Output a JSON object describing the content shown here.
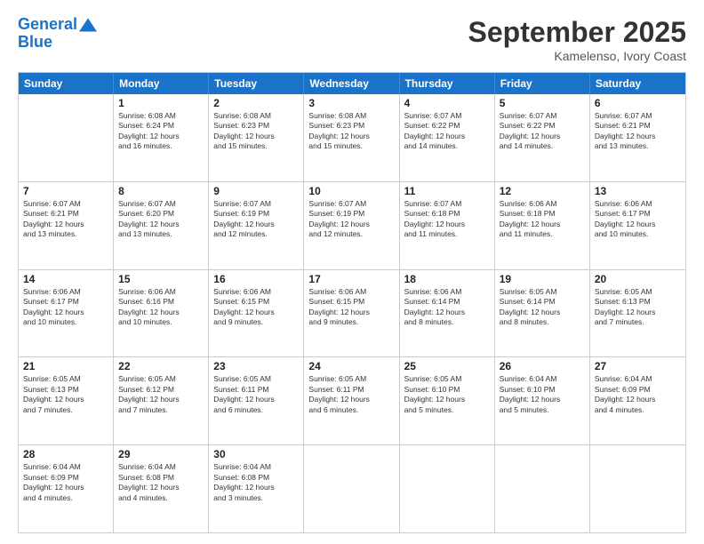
{
  "header": {
    "logo_line1": "General",
    "logo_line2": "Blue",
    "month": "September 2025",
    "location": "Kamelenso, Ivory Coast"
  },
  "days_of_week": [
    "Sunday",
    "Monday",
    "Tuesday",
    "Wednesday",
    "Thursday",
    "Friday",
    "Saturday"
  ],
  "weeks": [
    [
      {
        "day": "",
        "info": ""
      },
      {
        "day": "1",
        "info": "Sunrise: 6:08 AM\nSunset: 6:24 PM\nDaylight: 12 hours\nand 16 minutes."
      },
      {
        "day": "2",
        "info": "Sunrise: 6:08 AM\nSunset: 6:23 PM\nDaylight: 12 hours\nand 15 minutes."
      },
      {
        "day": "3",
        "info": "Sunrise: 6:08 AM\nSunset: 6:23 PM\nDaylight: 12 hours\nand 15 minutes."
      },
      {
        "day": "4",
        "info": "Sunrise: 6:07 AM\nSunset: 6:22 PM\nDaylight: 12 hours\nand 14 minutes."
      },
      {
        "day": "5",
        "info": "Sunrise: 6:07 AM\nSunset: 6:22 PM\nDaylight: 12 hours\nand 14 minutes."
      },
      {
        "day": "6",
        "info": "Sunrise: 6:07 AM\nSunset: 6:21 PM\nDaylight: 12 hours\nand 13 minutes."
      }
    ],
    [
      {
        "day": "7",
        "info": "Sunrise: 6:07 AM\nSunset: 6:21 PM\nDaylight: 12 hours\nand 13 minutes."
      },
      {
        "day": "8",
        "info": "Sunrise: 6:07 AM\nSunset: 6:20 PM\nDaylight: 12 hours\nand 13 minutes."
      },
      {
        "day": "9",
        "info": "Sunrise: 6:07 AM\nSunset: 6:19 PM\nDaylight: 12 hours\nand 12 minutes."
      },
      {
        "day": "10",
        "info": "Sunrise: 6:07 AM\nSunset: 6:19 PM\nDaylight: 12 hours\nand 12 minutes."
      },
      {
        "day": "11",
        "info": "Sunrise: 6:07 AM\nSunset: 6:18 PM\nDaylight: 12 hours\nand 11 minutes."
      },
      {
        "day": "12",
        "info": "Sunrise: 6:06 AM\nSunset: 6:18 PM\nDaylight: 12 hours\nand 11 minutes."
      },
      {
        "day": "13",
        "info": "Sunrise: 6:06 AM\nSunset: 6:17 PM\nDaylight: 12 hours\nand 10 minutes."
      }
    ],
    [
      {
        "day": "14",
        "info": "Sunrise: 6:06 AM\nSunset: 6:17 PM\nDaylight: 12 hours\nand 10 minutes."
      },
      {
        "day": "15",
        "info": "Sunrise: 6:06 AM\nSunset: 6:16 PM\nDaylight: 12 hours\nand 10 minutes."
      },
      {
        "day": "16",
        "info": "Sunrise: 6:06 AM\nSunset: 6:15 PM\nDaylight: 12 hours\nand 9 minutes."
      },
      {
        "day": "17",
        "info": "Sunrise: 6:06 AM\nSunset: 6:15 PM\nDaylight: 12 hours\nand 9 minutes."
      },
      {
        "day": "18",
        "info": "Sunrise: 6:06 AM\nSunset: 6:14 PM\nDaylight: 12 hours\nand 8 minutes."
      },
      {
        "day": "19",
        "info": "Sunrise: 6:05 AM\nSunset: 6:14 PM\nDaylight: 12 hours\nand 8 minutes."
      },
      {
        "day": "20",
        "info": "Sunrise: 6:05 AM\nSunset: 6:13 PM\nDaylight: 12 hours\nand 7 minutes."
      }
    ],
    [
      {
        "day": "21",
        "info": "Sunrise: 6:05 AM\nSunset: 6:13 PM\nDaylight: 12 hours\nand 7 minutes."
      },
      {
        "day": "22",
        "info": "Sunrise: 6:05 AM\nSunset: 6:12 PM\nDaylight: 12 hours\nand 7 minutes."
      },
      {
        "day": "23",
        "info": "Sunrise: 6:05 AM\nSunset: 6:11 PM\nDaylight: 12 hours\nand 6 minutes."
      },
      {
        "day": "24",
        "info": "Sunrise: 6:05 AM\nSunset: 6:11 PM\nDaylight: 12 hours\nand 6 minutes."
      },
      {
        "day": "25",
        "info": "Sunrise: 6:05 AM\nSunset: 6:10 PM\nDaylight: 12 hours\nand 5 minutes."
      },
      {
        "day": "26",
        "info": "Sunrise: 6:04 AM\nSunset: 6:10 PM\nDaylight: 12 hours\nand 5 minutes."
      },
      {
        "day": "27",
        "info": "Sunrise: 6:04 AM\nSunset: 6:09 PM\nDaylight: 12 hours\nand 4 minutes."
      }
    ],
    [
      {
        "day": "28",
        "info": "Sunrise: 6:04 AM\nSunset: 6:09 PM\nDaylight: 12 hours\nand 4 minutes."
      },
      {
        "day": "29",
        "info": "Sunrise: 6:04 AM\nSunset: 6:08 PM\nDaylight: 12 hours\nand 4 minutes."
      },
      {
        "day": "30",
        "info": "Sunrise: 6:04 AM\nSunset: 6:08 PM\nDaylight: 12 hours\nand 3 minutes."
      },
      {
        "day": "",
        "info": ""
      },
      {
        "day": "",
        "info": ""
      },
      {
        "day": "",
        "info": ""
      },
      {
        "day": "",
        "info": ""
      }
    ]
  ]
}
